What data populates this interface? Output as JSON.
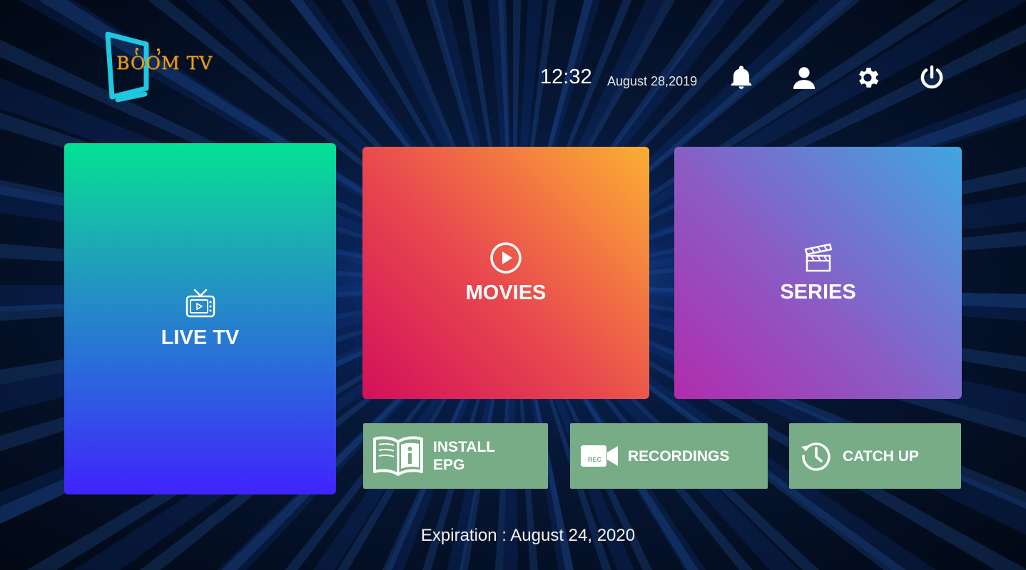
{
  "brand": {
    "name": "BOOM TV",
    "text_color": "#e8a022",
    "screen_color": "#1fc7e0"
  },
  "header": {
    "time": "12:32",
    "date": "August 28,2019",
    "icons": [
      "bell-icon",
      "user-icon",
      "gear-icon",
      "power-icon"
    ]
  },
  "tiles": {
    "live_tv": {
      "label": "LIVE TV",
      "icon": "tv-icon",
      "colors": [
        "#03e294",
        "#4023fd"
      ]
    },
    "movies": {
      "label": "MOVIES",
      "icon": "play-circle-icon",
      "colors": [
        "#d3105a",
        "#fbaf33"
      ]
    },
    "series": {
      "label": "SERIES",
      "icon": "clapperboard-icon",
      "colors": [
        "#b12cad",
        "#3fa6e2"
      ]
    }
  },
  "actions": {
    "install_epg": {
      "line1": "INSTALL",
      "line2": "EPG",
      "icon": "book-info-icon"
    },
    "recordings": {
      "label": "RECORDINGS",
      "badge": "REC",
      "icon": "rec-camera-icon"
    },
    "catch_up": {
      "label": "CATCH UP",
      "icon": "history-clock-icon"
    },
    "color": "#77ac86"
  },
  "footer": {
    "expiration": "Expiration : August 24, 2020"
  }
}
